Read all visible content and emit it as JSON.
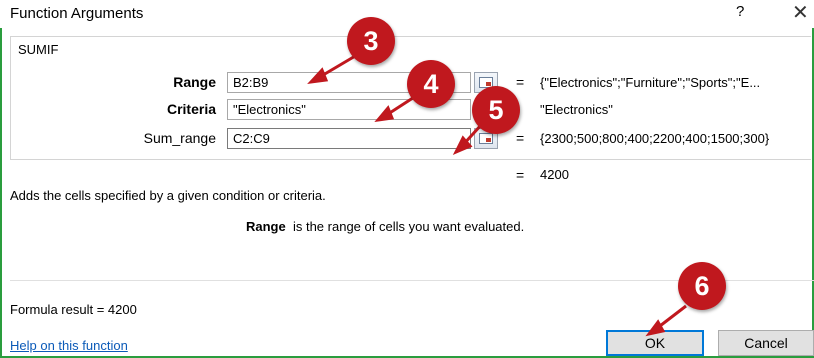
{
  "dialog": {
    "title": "Function Arguments",
    "help_glyph": "?",
    "close_glyph": "✕"
  },
  "function": {
    "name": "SUMIF",
    "args": [
      {
        "label": "Range",
        "value": "B2:B9",
        "eq": "=",
        "result": "{\"Electronics\";\"Furniture\";\"Sports\";\"E..."
      },
      {
        "label": "Criteria",
        "value": "\"Electronics\"",
        "eq": "=",
        "result": "\"Electronics\""
      },
      {
        "label": "Sum_range",
        "value": "C2:C9",
        "eq": "=",
        "result": "{2300;500;800;400;2200;400;1500;300}"
      }
    ],
    "total_eq": "=",
    "total": "4200",
    "description": "Adds the cells specified by a given condition or criteria.",
    "arg_description_name": "Range",
    "arg_description_text": "is the range of cells you want evaluated."
  },
  "footer": {
    "formula_result": "Formula result =   4200",
    "help_link": "Help on this function",
    "ok_label": "OK",
    "cancel_label": "Cancel"
  },
  "badges": [
    "3",
    "4",
    "5",
    "6"
  ],
  "colors": {
    "badge": "#c0181e",
    "frame": "#2a9d3e",
    "link": "#0b5ab8",
    "ok_border": "#0078d7"
  }
}
